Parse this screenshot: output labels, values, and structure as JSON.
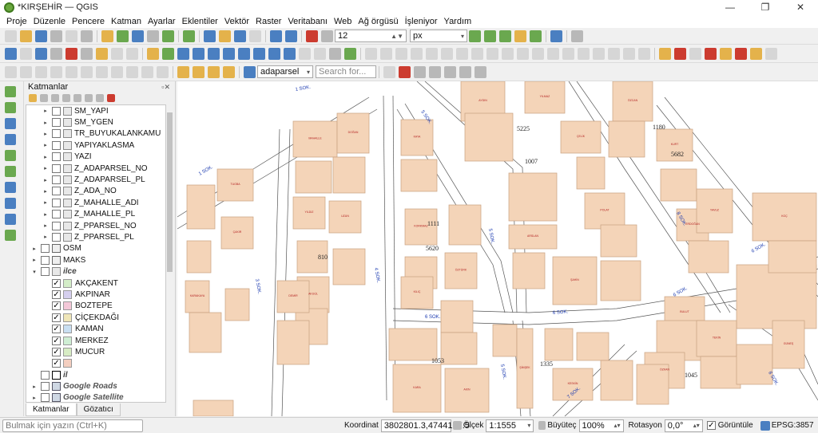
{
  "window": {
    "title": "*KIRŞEHİR — QGIS",
    "minimize": "—",
    "maximize": "❐",
    "close": "✕"
  },
  "menu": [
    "Proje",
    "Düzenle",
    "Pencere",
    "Katman",
    "Ayarlar",
    "Eklentiler",
    "Vektör",
    "Raster",
    "Veritabanı",
    "Web",
    "Ağ örgüsü",
    "İşleniyor",
    "Yardım"
  ],
  "toolbar": {
    "font_size": "12",
    "unit": "px",
    "search_layer": "adaparsel",
    "search_placeholder": "Search for..."
  },
  "panel": {
    "title": "Katmanlar",
    "layers": [
      {
        "name": "SM_YAPI",
        "indent": 1,
        "arrow": "▸",
        "check": "",
        "icon": "vec"
      },
      {
        "name": "SM_YGEN",
        "indent": 1,
        "arrow": "▸",
        "check": "",
        "icon": "vec"
      },
      {
        "name": "TR_BUYUKALANKAMU",
        "indent": 1,
        "arrow": "▸",
        "check": "",
        "icon": "vec"
      },
      {
        "name": "YAPIYAKLASMA",
        "indent": 1,
        "arrow": "▸",
        "check": "",
        "icon": "vec"
      },
      {
        "name": "YAZI",
        "indent": 1,
        "arrow": "▸",
        "check": "",
        "icon": "vec"
      },
      {
        "name": "Z_ADAPARSEL_NO",
        "indent": 1,
        "arrow": "▸",
        "check": "",
        "icon": "vec"
      },
      {
        "name": "Z_ADAPARSEL_PL",
        "indent": 1,
        "arrow": "▸",
        "check": "",
        "icon": "vec"
      },
      {
        "name": "Z_ADA_NO",
        "indent": 1,
        "arrow": "▸",
        "check": "",
        "icon": "vec"
      },
      {
        "name": "Z_MAHALLE_ADI",
        "indent": 1,
        "arrow": "▸",
        "check": "",
        "icon": "vec"
      },
      {
        "name": "Z_MAHALLE_PL",
        "indent": 1,
        "arrow": "▸",
        "check": "",
        "icon": "vec"
      },
      {
        "name": "Z_PPARSEL_NO",
        "indent": 1,
        "arrow": "▸",
        "check": "",
        "icon": "vec"
      },
      {
        "name": "Z_PPARSEL_PL",
        "indent": 1,
        "arrow": "▸",
        "check": "",
        "icon": "vec"
      },
      {
        "name": "OSM",
        "indent": 0,
        "arrow": "▸",
        "check": "",
        "icon": "grp"
      },
      {
        "name": "MAKS",
        "indent": 0,
        "arrow": "▸",
        "check": "",
        "icon": "grp"
      },
      {
        "name": "ilce",
        "indent": 0,
        "arrow": "▾",
        "check": "",
        "icon": "poly",
        "style": "it"
      },
      {
        "name": "AKÇAKENT",
        "indent": 1,
        "arrow": "",
        "check": "✓",
        "icon": "sw",
        "color": "#d4edc8"
      },
      {
        "name": "AKPINAR",
        "indent": 1,
        "arrow": "",
        "check": "✓",
        "icon": "sw",
        "color": "#d5cfee"
      },
      {
        "name": "BOZTEPE",
        "indent": 1,
        "arrow": "",
        "check": "✓",
        "icon": "sw",
        "color": "#f3c8d8"
      },
      {
        "name": "ÇİÇEKDAĞI",
        "indent": 1,
        "arrow": "",
        "check": "✓",
        "icon": "sw",
        "color": "#efe6b8"
      },
      {
        "name": "KAMAN",
        "indent": 1,
        "arrow": "",
        "check": "✓",
        "icon": "sw",
        "color": "#c9dff2"
      },
      {
        "name": "MERKEZ",
        "indent": 1,
        "arrow": "",
        "check": "✓",
        "icon": "sw",
        "color": "#cfeed4"
      },
      {
        "name": "MUCUR",
        "indent": 1,
        "arrow": "",
        "check": "✓",
        "icon": "sw",
        "color": "#d7ecc4"
      },
      {
        "name": "",
        "indent": 1,
        "arrow": "",
        "check": "✓",
        "icon": "sw",
        "color": "#f4cfc0"
      },
      {
        "name": "il",
        "indent": 0,
        "arrow": "",
        "check": "",
        "icon": "ilbox",
        "style": "it"
      },
      {
        "name": "Google Roads",
        "indent": 0,
        "arrow": "▸",
        "check": "",
        "icon": "wms",
        "style": "itg"
      },
      {
        "name": "Google Satellite",
        "indent": 0,
        "arrow": "▸",
        "check": "",
        "icon": "wms",
        "style": "itg"
      }
    ],
    "tabs": [
      "Katmanlar",
      "Gözatıcı"
    ]
  },
  "map": {
    "streets": [
      "1 SOK.",
      "5 SOK.",
      "1 SOK.",
      "3 SOK.",
      "4 SOK.",
      "5 SOK.",
      "6 SOK.",
      "6 SOK.",
      "8 SOK.",
      "6 SOK.",
      "7 SOK.",
      "5 SOK.",
      "8 SOK.",
      "6 SOK."
    ],
    "ada_numbers": [
      "5225",
      "1180",
      "1007",
      "5682",
      "1111",
      "5620",
      "810",
      "1053",
      "1335",
      "1045"
    ],
    "parcel_labels": [
      "TUGBA",
      "ÇAKIR",
      "KARAKAYA",
      "MAHALLE",
      "YILDIZ",
      "AKGÜL",
      "DOĞAN",
      "UZUN",
      "DEMİR",
      "KAYA",
      "KORKMAZ",
      "KILIÇ",
      "ÖZTÜRK",
      "AYDIN",
      "YILMAZ",
      "ARSLAN",
      "ŞAHİN",
      "ÇELİK",
      "POLAT",
      "ÖZCAN",
      "KURT",
      "ERDOĞAN",
      "YAVUZ",
      "KOÇ",
      "BULUT",
      "TEKİN",
      "ÖZKAN",
      "GÜNEŞ",
      "KARA",
      "AKIN",
      "ŞİMŞEK",
      "KESKİN"
    ]
  },
  "status": {
    "search_placeholder": "Bulmak için yazın (Ctrl+K)",
    "coord_label": "Koordinat",
    "coord_value": "3802801.3,4744107.5",
    "scale_label": "Ölçek",
    "scale_value": "1:1555",
    "mag_label": "Büyüteç",
    "mag_value": "100%",
    "rot_label": "Rotasyon",
    "rot_value": "0,0°",
    "render_label": "Görüntüle",
    "epsg": "EPSG:3857"
  }
}
